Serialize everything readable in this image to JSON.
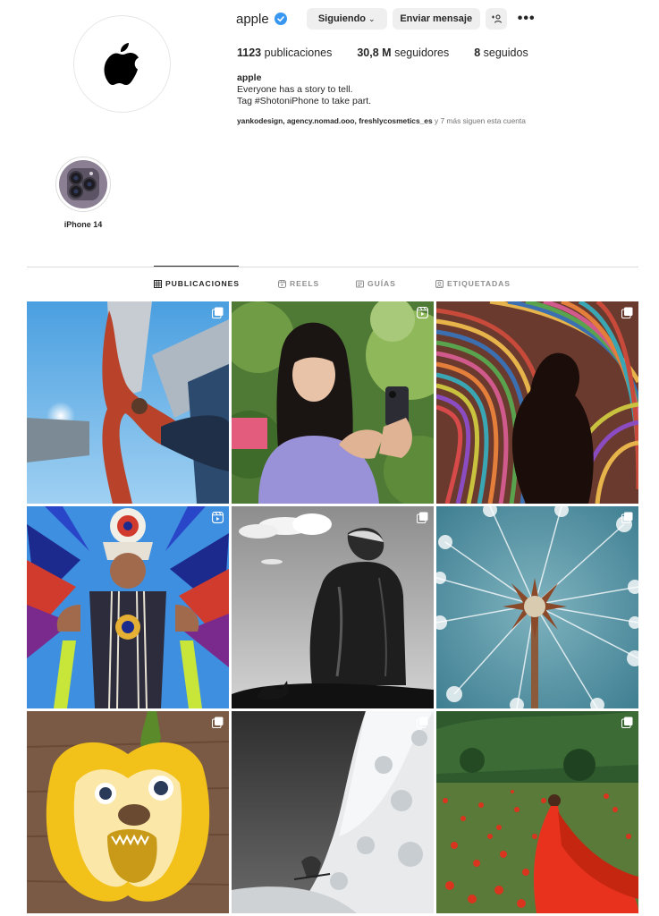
{
  "profile": {
    "username": "apple",
    "following_label": "Siguiendo",
    "message_label": "Enviar mensaje",
    "add_user_label": "+",
    "more_label": "•••",
    "posts_count": "1123",
    "posts_label": "publicaciones",
    "followers_count": "30,8 M",
    "followers_label": "seguidores",
    "following_count": "8",
    "following_text": "seguidos",
    "bio_name": "apple",
    "bio_line1": "Everyone has a story to tell.",
    "bio_line2": "Tag #ShotoniPhone to take part.",
    "followed_by_names": "yankodesign, agency.nomad.ooo, freshlycosmetics_es",
    "followed_by_rest": "y 7 más siguen esta cuenta"
  },
  "highlight": {
    "label": "iPhone 14"
  },
  "tabs": [
    {
      "label": "PUBLICACIONES",
      "icon": "grid-icon",
      "active": true
    },
    {
      "label": "REELS",
      "icon": "reels-icon",
      "active": false
    },
    {
      "label": "GUÍAS",
      "icon": "guides-icon",
      "active": false
    },
    {
      "label": "ETIQUETADAS",
      "icon": "tagged-icon",
      "active": false
    }
  ],
  "posts": [
    {
      "subject": "man-jumping-between-buildings",
      "badge": "carousel-icon"
    },
    {
      "subject": "girl-with-phone-in-garden",
      "badge": "reel-icon"
    },
    {
      "subject": "silhouette-striped-tunnel",
      "badge": "carousel-icon"
    },
    {
      "subject": "dancer-feather-regalia",
      "badge": "reel-icon"
    },
    {
      "subject": "man-on-rock-black-white",
      "badge": "carousel-icon"
    },
    {
      "subject": "dandelion-macro",
      "badge": "carousel-icon"
    },
    {
      "subject": "pepper-face",
      "badge": "carousel-icon"
    },
    {
      "subject": "snow-cliff-skier",
      "badge": "carousel-icon"
    },
    {
      "subject": "woman-red-dress-poppy-field",
      "badge": "carousel-icon"
    }
  ],
  "colors": {
    "verified": "#3897f0",
    "text": "#262626",
    "muted": "#8e8e8e",
    "button_bg": "#efefef"
  }
}
